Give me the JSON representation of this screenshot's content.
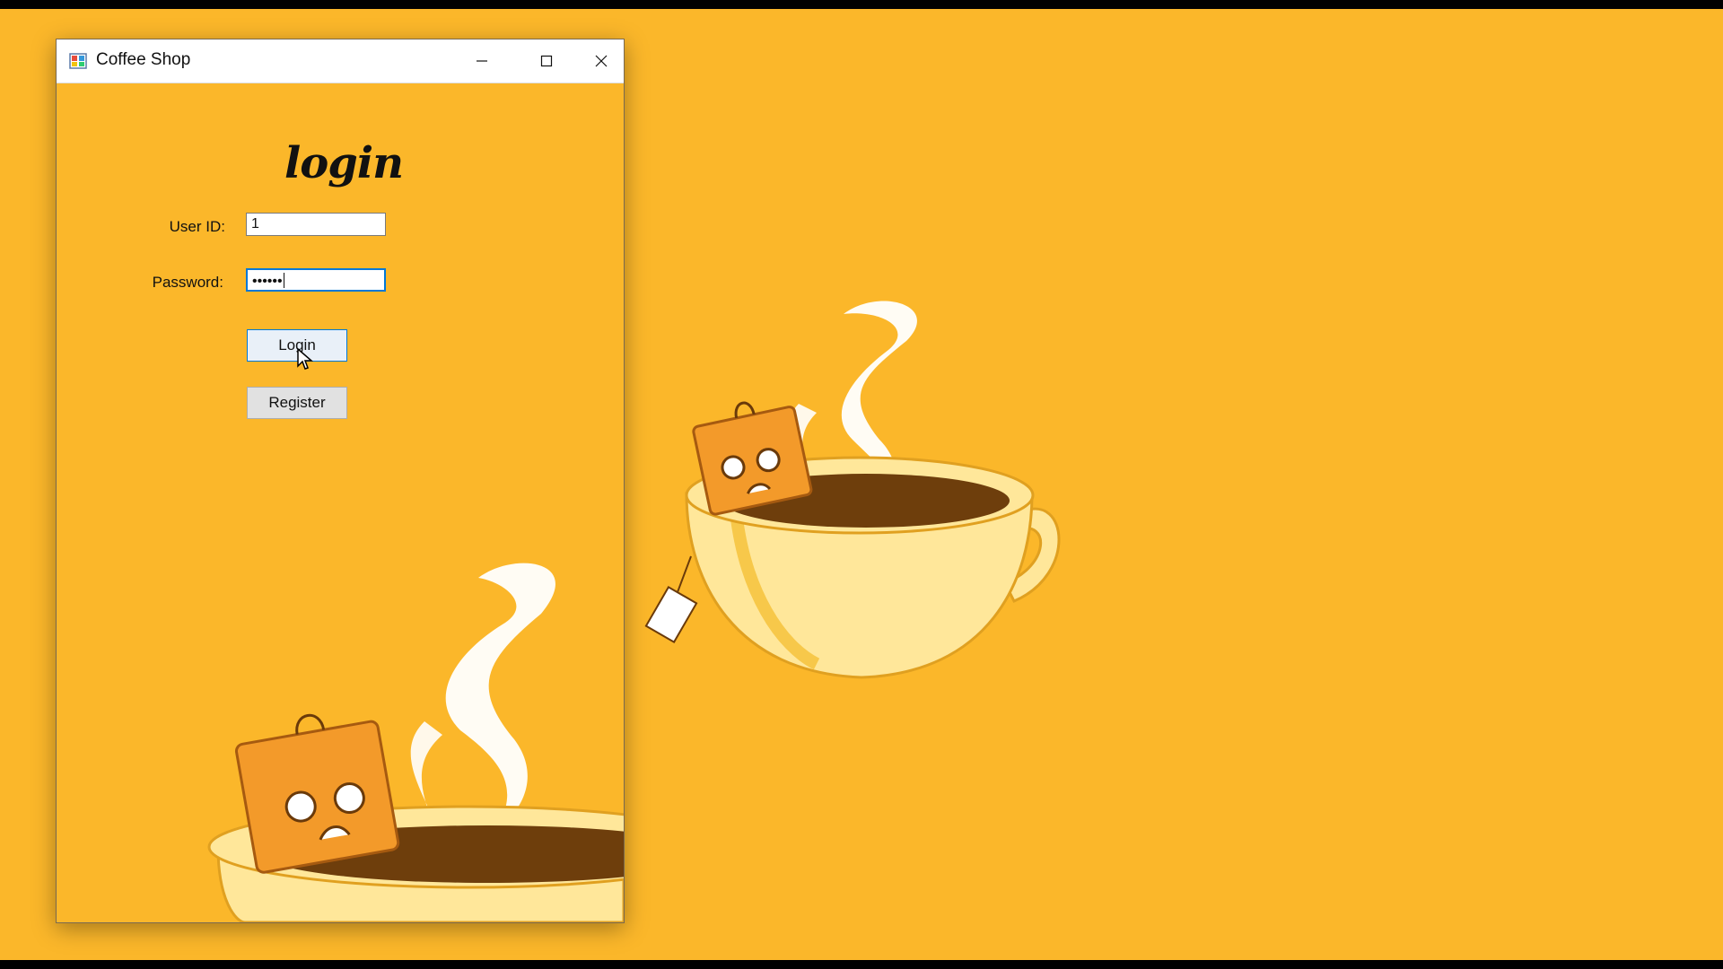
{
  "window": {
    "title": "Coffee Shop",
    "icons": {
      "app": "app-icon",
      "minimize": "minimize-icon",
      "maximize": "maximize-icon",
      "close": "close-icon"
    }
  },
  "form": {
    "heading": "login",
    "userid_label": "User ID:",
    "userid_value": "1",
    "password_label": "Password:",
    "password_value": "••••••",
    "login_button": "Login",
    "register_button": "Register"
  },
  "colors": {
    "background": "#FBB72A",
    "accent": "#0078d7"
  }
}
